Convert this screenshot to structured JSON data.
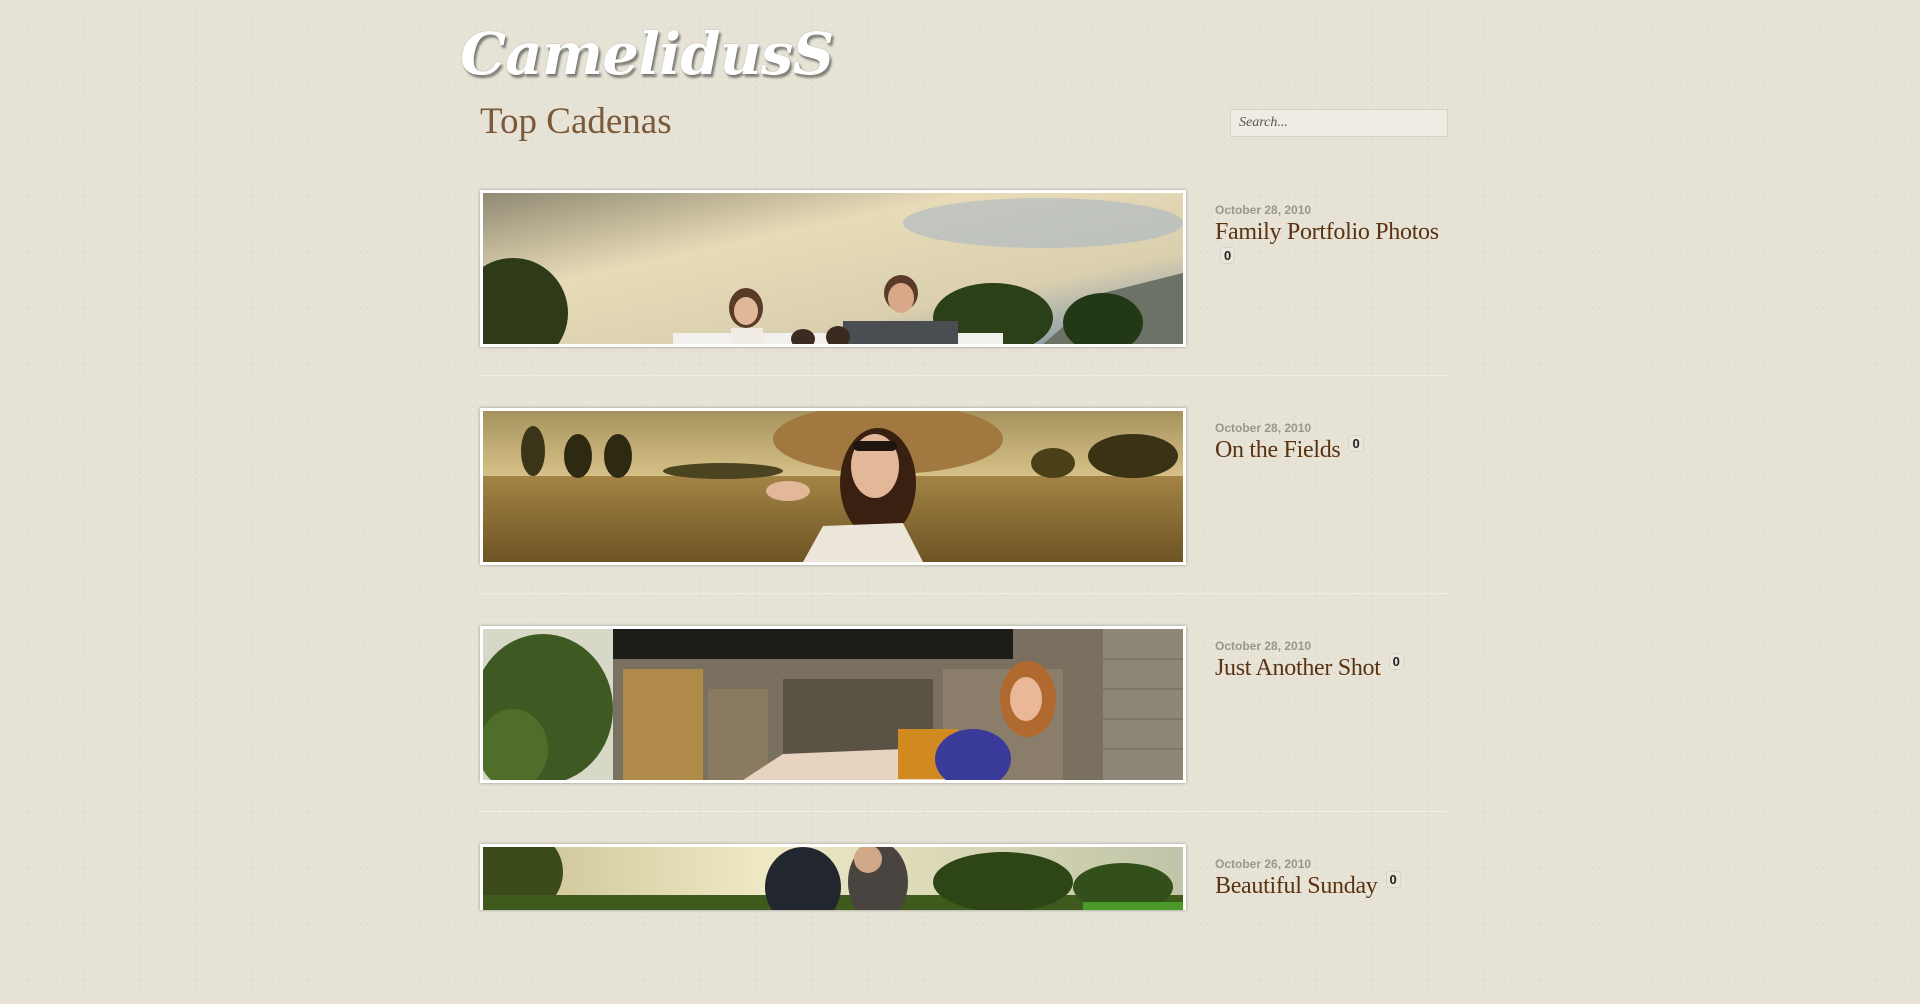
{
  "site": {
    "logo": "CamelidusS"
  },
  "page": {
    "title": "Top Cadenas"
  },
  "search": {
    "placeholder": "Search..."
  },
  "posts": [
    {
      "date": "October 28, 2010",
      "title": "Family Portfolio Photos",
      "comments": "0"
    },
    {
      "date": "October 28, 2010",
      "title": "On the Fields",
      "comments": "0"
    },
    {
      "date": "October 28, 2010",
      "title": "Just Another Shot",
      "comments": "0"
    },
    {
      "date": "October 26, 2010",
      "title": "Beautiful Sunday",
      "comments": "0"
    }
  ],
  "colors": {
    "background": "#e6e3d6",
    "title_brown": "#7a5a3a",
    "post_title": "#5a3210",
    "date_grey": "#9a968a"
  }
}
